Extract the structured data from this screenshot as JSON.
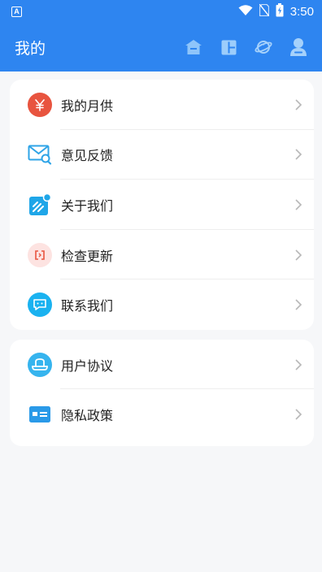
{
  "status_bar": {
    "time": "3:50",
    "app_indicator": "A"
  },
  "header": {
    "title": "我的",
    "icons": [
      "home-icon",
      "layout-icon",
      "planet-icon",
      "user-icon"
    ]
  },
  "colors": {
    "brand": "#2e85f0",
    "background": "#f6f7f9"
  },
  "menu_group_1": {
    "items": [
      {
        "label": "我的月供",
        "icon": "yuan-icon",
        "icon_color": "#e8543f"
      },
      {
        "label": "意见反馈",
        "icon": "mail-search-icon",
        "icon_color": "#2fa4e7"
      },
      {
        "label": "关于我们",
        "icon": "about-icon",
        "icon_color": "#1fa6e8"
      },
      {
        "label": "检查更新",
        "icon": "update-icon",
        "icon_color": "#fde3e1"
      },
      {
        "label": "联系我们",
        "icon": "chat-icon",
        "icon_color": "#1ab2f0"
      }
    ]
  },
  "menu_group_2": {
    "items": [
      {
        "label": "用户协议",
        "icon": "hat-icon",
        "icon_color": "#36b4ee"
      },
      {
        "label": "隐私政策",
        "icon": "id-card-icon",
        "icon_color": "#2a9ae8"
      }
    ]
  }
}
